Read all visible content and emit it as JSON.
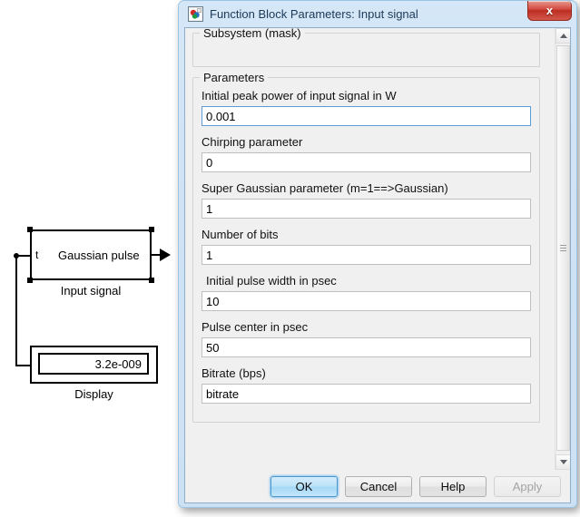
{
  "canvas": {
    "gaussian_block": {
      "port_tag": "t",
      "inner_label": "Gaussian pulse",
      "caption": "Input signal"
    },
    "display_block": {
      "value": "3.2e-009",
      "caption": "Display"
    }
  },
  "dialog": {
    "icon": "simulink-icon",
    "title": "Function Block Parameters: Input signal",
    "close_label": "x",
    "subsystem_group_title": "Subsystem (mask)",
    "parameters_group_title": "Parameters",
    "fields": [
      {
        "label": "Initial peak power of input signal in W",
        "value": "0.001",
        "focused": true,
        "indent": false
      },
      {
        "label": "Chirping parameter",
        "value": "0",
        "focused": false,
        "indent": false
      },
      {
        "label": "Super Gaussian parameter (m=1==>Gaussian)",
        "value": "1",
        "focused": false,
        "indent": false
      },
      {
        "label": "Number of bits",
        "value": "1",
        "focused": false,
        "indent": false
      },
      {
        "label": "Initial pulse width in psec",
        "value": "10",
        "focused": false,
        "indent": true
      },
      {
        "label": "Pulse center in psec",
        "value": "50",
        "focused": false,
        "indent": false
      },
      {
        "label": "Bitrate (bps)",
        "value": "bitrate",
        "focused": false,
        "indent": false
      }
    ],
    "buttons": {
      "ok": "OK",
      "cancel": "Cancel",
      "help": "Help",
      "apply": "Apply"
    }
  },
  "colors": {
    "accent": "#3a8fd4",
    "close_red": "#c2372b",
    "dialog_chrome": "#cfe3f5",
    "client_bg": "#f0f0f0"
  }
}
